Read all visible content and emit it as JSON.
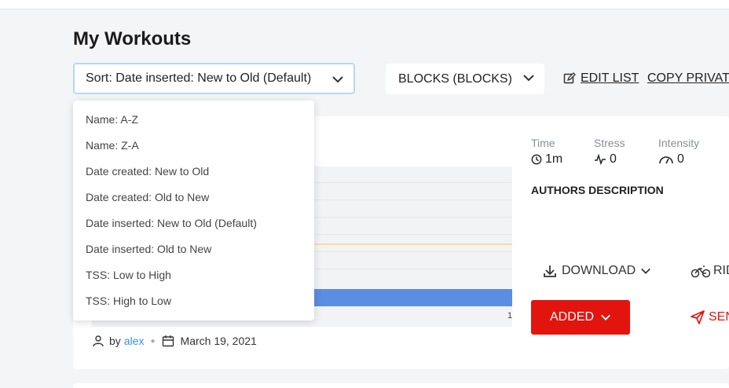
{
  "page": {
    "title": "My Workouts"
  },
  "toolbar": {
    "sort_label": "Sort: Date inserted: New to Old (Default)",
    "blocks_label": "BLOCKS (BLOCKS)",
    "edit_list_label": "EDIT LIST",
    "copy_private_label": "COPY PRIVATE"
  },
  "sort_menu": {
    "options": [
      "Name: A-Z",
      "Name: Z-A",
      "Date created: New to Old",
      "Date created: Old to New",
      "Date inserted: New to Old (Default)",
      "Date inserted: Old to New",
      "TSS: Low to High",
      "TSS: High to Low"
    ]
  },
  "workout": {
    "stats": [
      {
        "label": "Time",
        "value": "1m",
        "icon": "clock-icon"
      },
      {
        "label": "Stress",
        "value": "0",
        "icon": "pulse-icon"
      },
      {
        "label": "Intensity",
        "value": "0",
        "icon": "gauge-icon"
      }
    ],
    "authors_description_label": "AUTHORS DESCRIPTION",
    "download_label": "DOWNLOAD",
    "ride_label": "RIDE",
    "added_label": "ADDED",
    "send_label": "SEND",
    "author_prefix": "by",
    "author_name": "alex",
    "date": "March 19, 2021",
    "chart_tick": "1"
  },
  "colors": {
    "accent_red": "#e3140e",
    "bar_blue": "#5b8ee0",
    "link_blue": "#3a8ee6",
    "ftp_line": "#f3dfa5"
  }
}
